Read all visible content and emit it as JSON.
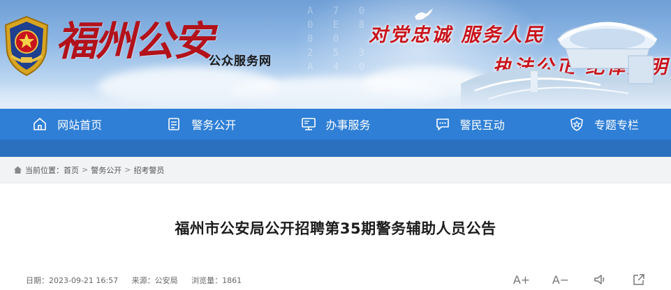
{
  "header": {
    "logo_text": "福州公安",
    "site_subtitle": "公众服务网",
    "slogan_line1": "对党忠诚 服务人民",
    "slogan_line2": "执法公正 纪律严明"
  },
  "nav": {
    "items": [
      {
        "label": "网站首页",
        "icon": "home-icon"
      },
      {
        "label": "警务公开",
        "icon": "document-icon"
      },
      {
        "label": "办事服务",
        "icon": "monitor-icon"
      },
      {
        "label": "警民互动",
        "icon": "chat-icon"
      },
      {
        "label": "专题专栏",
        "icon": "badge-icon"
      }
    ]
  },
  "breadcrumb": {
    "prefix": "当前位置：",
    "items": [
      "首页",
      "警务公开",
      "招考警员"
    ],
    "separator": ">"
  },
  "article": {
    "title": "福州市公安局公开招聘第35期警务辅助人员公告",
    "date_label": "日期：",
    "date": "2023-09-21 16:57",
    "source_label": "来源：",
    "source": "公安局",
    "views_label": "浏览量：",
    "views": "1861"
  },
  "tools": {
    "font_increase": "A+",
    "font_decrease": "A−",
    "speaker_icon": "speaker-icon",
    "share_icon": "share-icon"
  },
  "colors": {
    "nav_bg": "#2f7fd6",
    "nav_under": "#2b6fbf",
    "brand_red": "#c8141c",
    "breadcrumb_bg": "#f2f3f5"
  }
}
